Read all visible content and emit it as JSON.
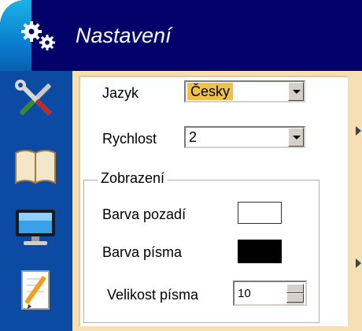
{
  "window": {
    "title": "Nastavení",
    "accent_color": "#03026b",
    "sidebar_color": "#0b4ba3",
    "content_color": "#f5dfb3"
  },
  "sidebar": {
    "items": [
      {
        "icon": "tools-icon"
      },
      {
        "icon": "book-icon"
      },
      {
        "icon": "monitor-icon"
      },
      {
        "icon": "notepad-pencil-icon"
      }
    ]
  },
  "settings": {
    "language": {
      "label": "Jazyk",
      "value": "Česky"
    },
    "speed": {
      "label": "Rychlost",
      "value": "2"
    }
  },
  "display": {
    "group_title": "Zobrazení",
    "background_color": {
      "label": "Barva pozadí",
      "value": "#ffffff"
    },
    "font_color": {
      "label": "Barva písma",
      "value": "#000000"
    },
    "font_size": {
      "label": "Velikost písma",
      "value": "10"
    }
  }
}
